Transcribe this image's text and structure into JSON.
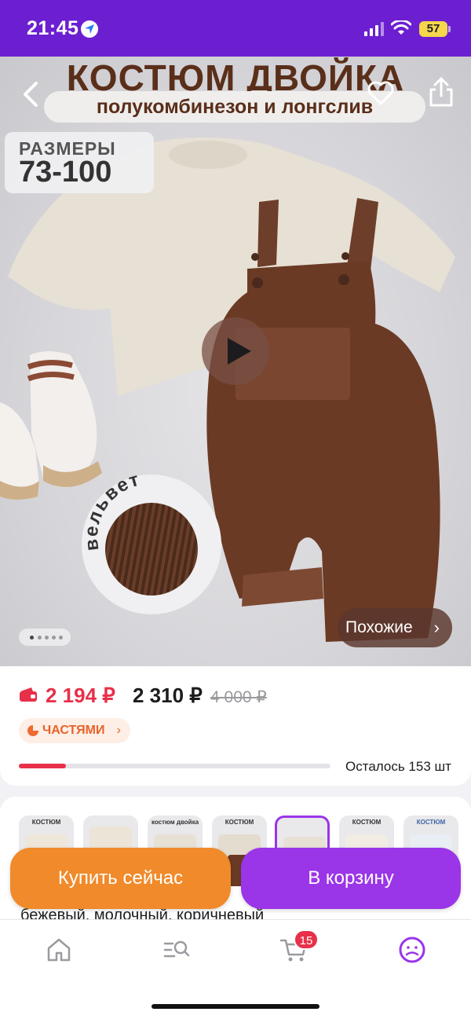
{
  "status_bar": {
    "time": "21:45",
    "battery": "57"
  },
  "hero": {
    "title": "КОСТЮМ ДВОЙКА",
    "subtitle": "полукомбинезон и лонгслив",
    "sizes_label": "РАЗМЕРЫ",
    "sizes_value": "73-100",
    "velvet_label": "вельвет",
    "similar_label": "Похожие",
    "slides_total": 5,
    "slide_active": 1
  },
  "price": {
    "card_price": "2 194 ₽",
    "price": "2 310 ₽",
    "old_price": "4 000 ₽",
    "installments_label": "ЧАСТЯМИ",
    "stock_text": "Осталось 153 шт"
  },
  "variants": {
    "items": [
      {
        "label": "КОСТЮМ"
      },
      {
        "label": ""
      },
      {
        "label": "костюм двойка"
      },
      {
        "label": "КОСТЮМ"
      },
      {
        "label": ""
      },
      {
        "label": "КОСТЮМ"
      },
      {
        "label": "КОСТЮМ"
      }
    ],
    "color_text": "бежевый, молочный, коричневый"
  },
  "actions": {
    "buy_now": "Купить сейчас",
    "add_to_cart": "В корзину"
  },
  "nav": {
    "cart_count": "15"
  },
  "colors": {
    "brand": "#6c1fd1",
    "accent": "#9b35e8",
    "buy": "#f08a2b",
    "price": "#e8304a"
  }
}
